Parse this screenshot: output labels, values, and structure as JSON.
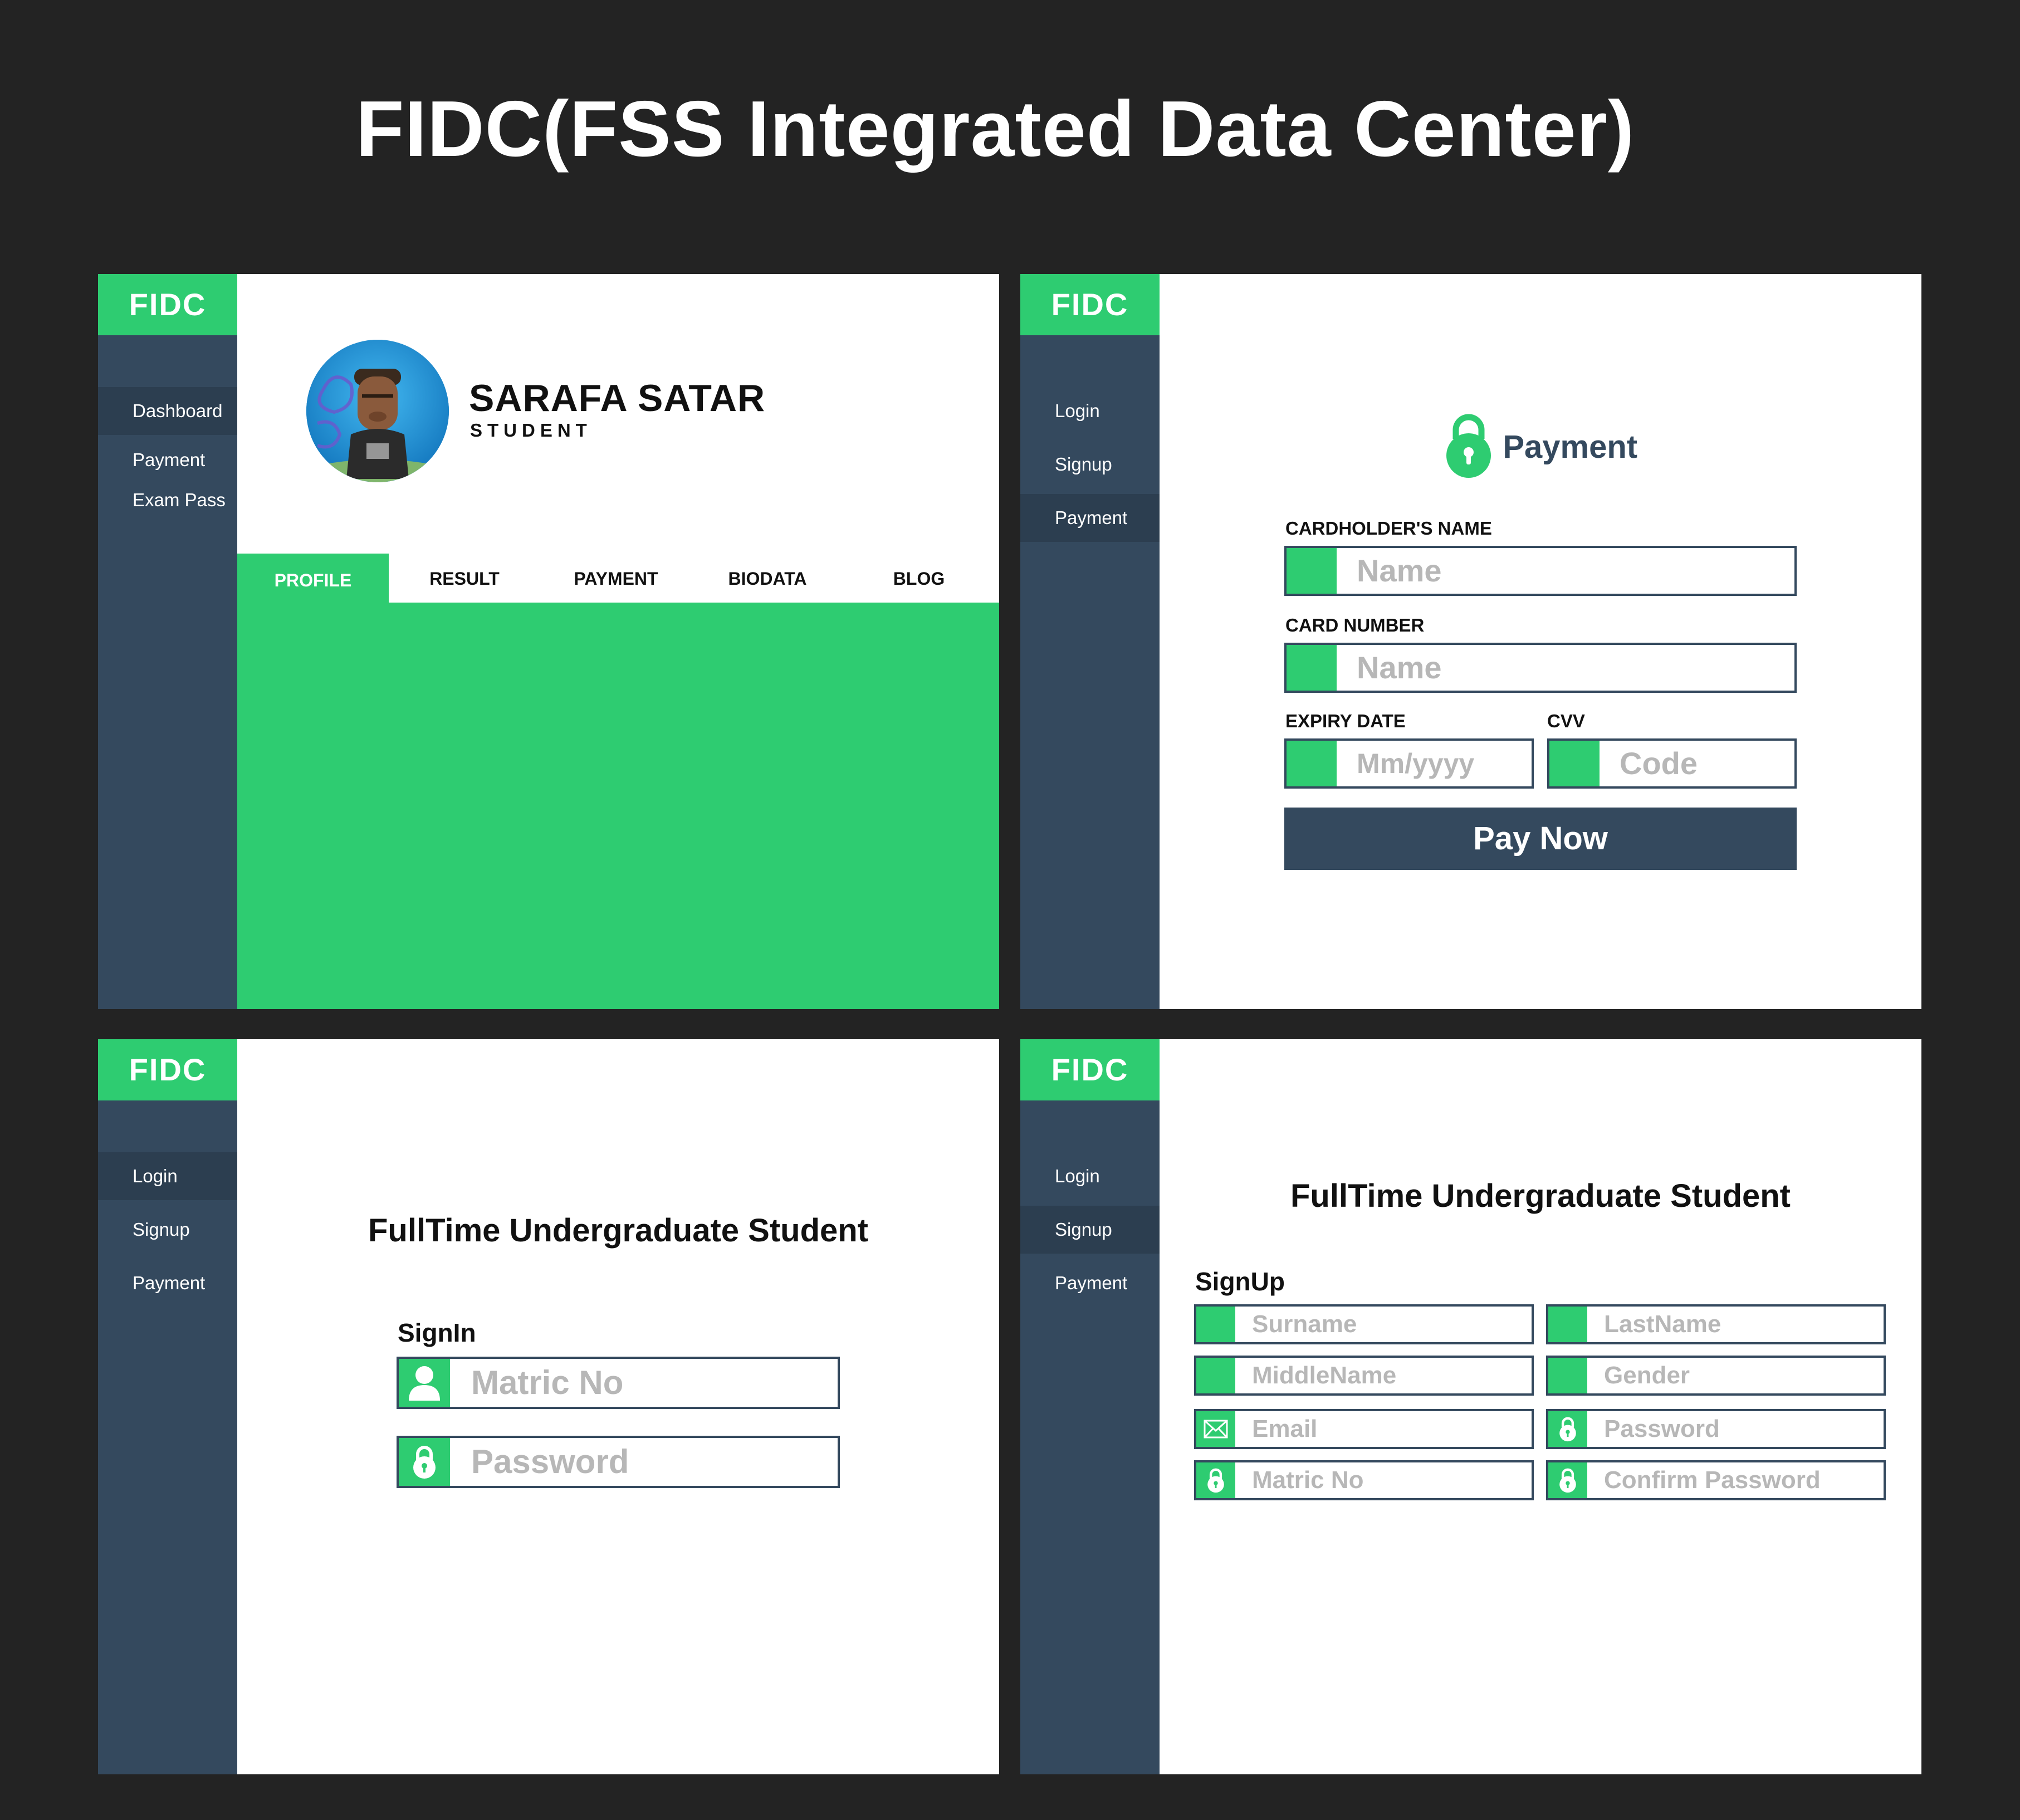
{
  "title": "FIDC(FSS Integrated Data Center)",
  "brand": "FIDC",
  "colors": {
    "green": "#2ecc71",
    "navy": "#34495e",
    "dark": "#232323"
  },
  "dashboard": {
    "nav": [
      "Dashboard",
      "Payment",
      "Exam Pass"
    ],
    "profile_name": "SARAFA SATAR",
    "profile_role": "STUDENT",
    "tabs": [
      "PROFILE",
      "RESULT",
      "PAYMENT",
      "BIODATA",
      "BLOG"
    ]
  },
  "payment": {
    "nav": [
      "Login",
      "Signup",
      "Payment"
    ],
    "heading": "Payment",
    "cardholder_label": "CARDHOLDER'S NAME",
    "cardholder_placeholder": "Name",
    "card_number_label": "CARD NUMBER",
    "card_number_placeholder": "Name",
    "expiry_label": "EXPIRY DATE",
    "expiry_placeholder": "Mm/yyyy",
    "cvv_label": "CVV",
    "cvv_placeholder": "Code",
    "pay_button": "Pay Now"
  },
  "login": {
    "nav": [
      "Login",
      "Signup",
      "Payment"
    ],
    "heading": "FullTime Undergraduate Student",
    "sub": "SignIn",
    "matric_placeholder": "Matric No",
    "password_placeholder": "Password"
  },
  "signup": {
    "nav": [
      "Login",
      "Signup",
      "Payment"
    ],
    "heading": "FullTime Undergraduate Student",
    "sub": "SignUp",
    "fields": {
      "surname": "Surname",
      "lastname": "LastName",
      "middlename": "MiddleName",
      "gender": "Gender",
      "email": "Email",
      "password": "Password",
      "matric": "Matric No",
      "confirm_password": "Confirm Password"
    }
  }
}
